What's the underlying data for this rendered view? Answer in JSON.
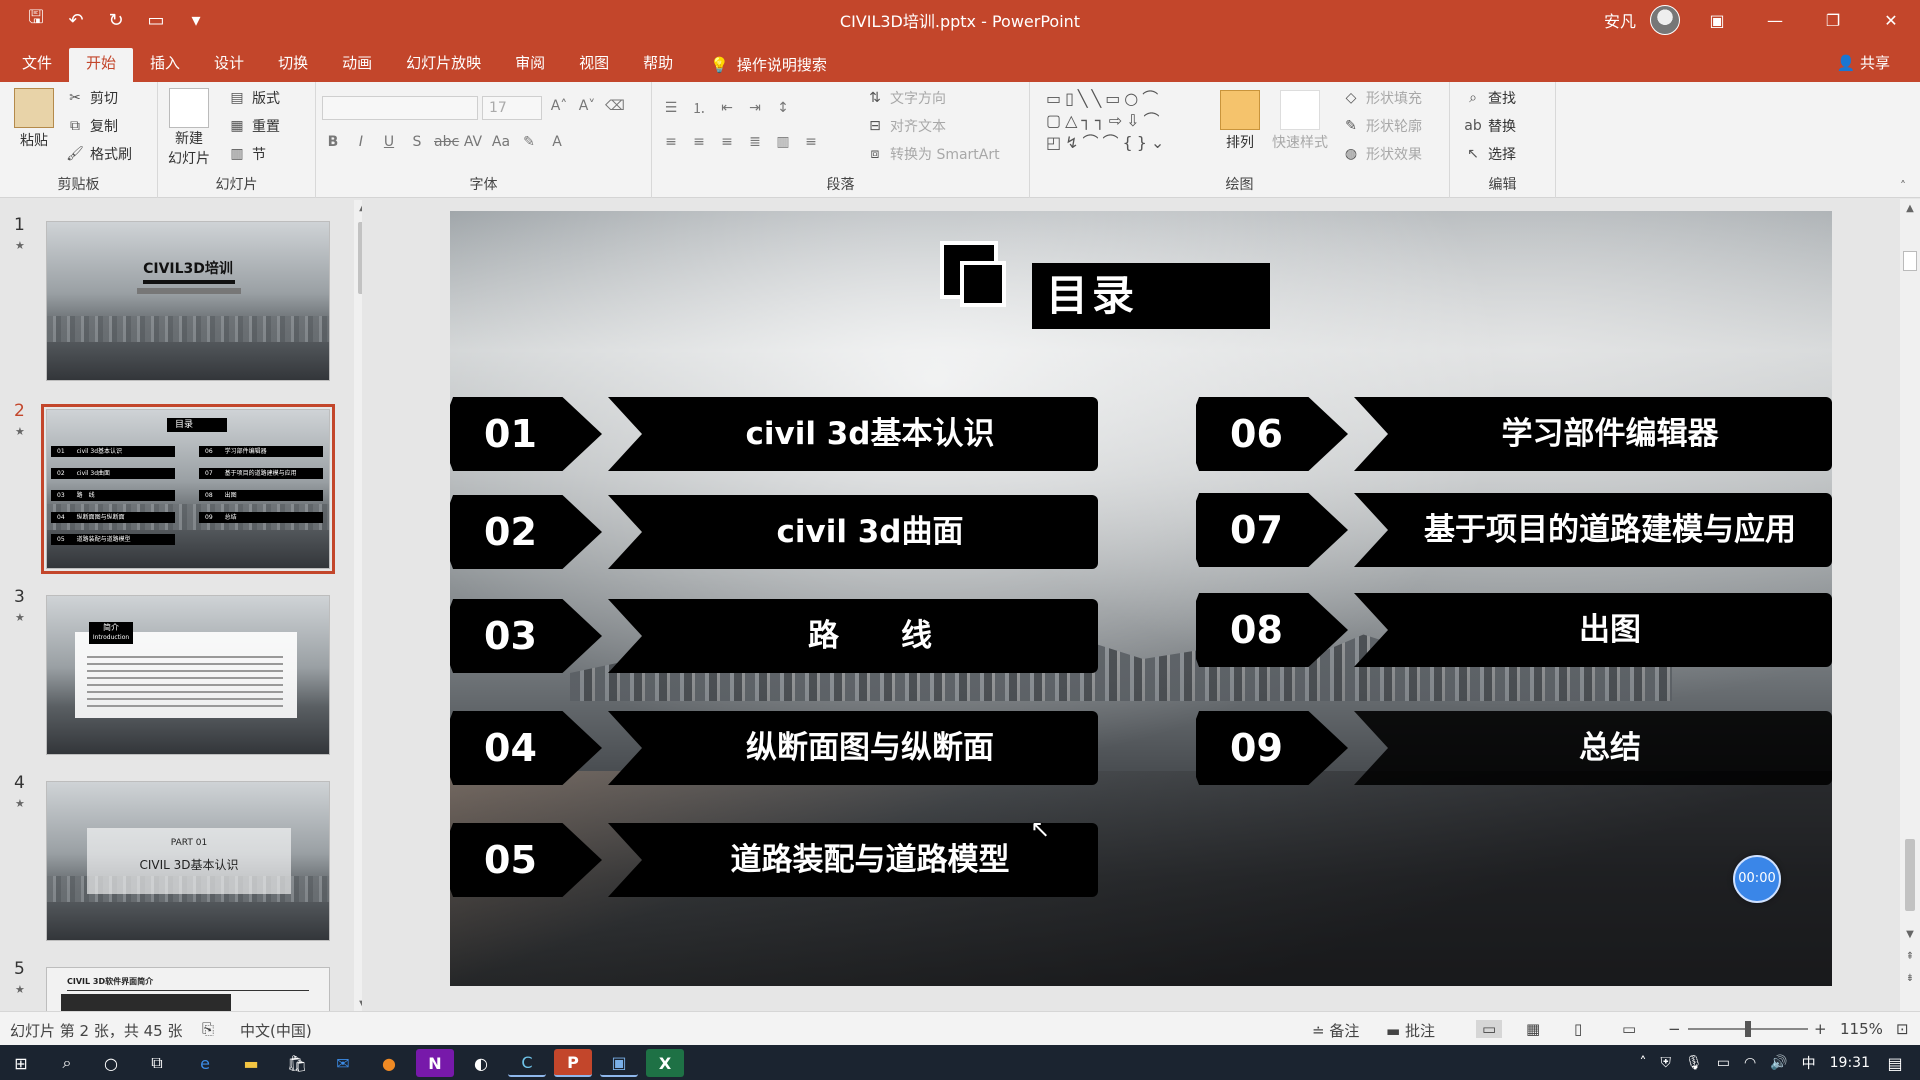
{
  "window": {
    "title": "CIVIL3D培训.pptx - PowerPoint",
    "user": "安凡"
  },
  "menu": {
    "tabs": [
      "文件",
      "开始",
      "插入",
      "设计",
      "切换",
      "动画",
      "幻灯片放映",
      "审阅",
      "视图",
      "帮助"
    ],
    "active_tab": "开始",
    "search_label": "操作说明搜索",
    "share_label": "共享"
  },
  "ribbon": {
    "clipboard": {
      "label": "剪贴板",
      "paste": "粘贴",
      "cut": "剪切",
      "copy": "复制",
      "format_painter": "格式刷"
    },
    "slides": {
      "label": "幻灯片",
      "new_slide": "新建",
      "new_slide2": "幻灯片",
      "layout": "版式",
      "reset": "重置",
      "section": "节"
    },
    "font": {
      "label": "字体",
      "size": "17"
    },
    "paragraph": {
      "label": "段落",
      "text_direction": "文字方向",
      "align_text": "对齐文本",
      "smartart": "转换为 SmartArt"
    },
    "drawing": {
      "label": "绘图",
      "arrange": "排列",
      "quick_styles": "快速样式",
      "shape_fill": "形状填充",
      "shape_outline": "形状轮廓",
      "shape_effects": "形状效果"
    },
    "editing": {
      "label": "编辑",
      "find": "查找",
      "replace": "替换",
      "select": "选择"
    }
  },
  "thumbnails": {
    "numbers": [
      "1",
      "2",
      "3",
      "4",
      "5"
    ],
    "active": "2",
    "t1_title": "CIVIL3D培训",
    "t2_title": "目录",
    "t3_tag1": "简介",
    "t3_tag2": "Introduction",
    "t4_part": "PART 01",
    "t4_name": "CIVIL 3D基本认识",
    "t5_title": "CIVIL 3D软件界面简介",
    "t2_rows": [
      {
        "n": "01",
        "t": "civil 3d基本认识"
      },
      {
        "n": "02",
        "t": "civil 3d曲面"
      },
      {
        "n": "03",
        "t": "路　线"
      },
      {
        "n": "04",
        "t": "纵断面图与纵断面"
      },
      {
        "n": "05",
        "t": "道路装配与道路模型"
      },
      {
        "n": "06",
        "t": "学习部件编辑器"
      },
      {
        "n": "07",
        "t": "基于项目的道路建模与应用"
      },
      {
        "n": "08",
        "t": "出图"
      },
      {
        "n": "09",
        "t": "总结"
      }
    ]
  },
  "slide": {
    "title": "目录",
    "left_items": [
      {
        "num": "01",
        "label": "civil 3d基本认识"
      },
      {
        "num": "02",
        "label": "civil 3d曲面"
      },
      {
        "num": "03",
        "label": "路　　线"
      },
      {
        "num": "04",
        "label": "纵断面图与纵断面"
      },
      {
        "num": "05",
        "label": "道路装配与道路模型"
      }
    ],
    "right_items": [
      {
        "num": "06",
        "label": "学习部件编辑器"
      },
      {
        "num": "07",
        "label": "基于项目的道路建模与应用"
      },
      {
        "num": "08",
        "label": "出图"
      },
      {
        "num": "09",
        "label": "总结"
      }
    ],
    "timer": "00:00"
  },
  "status": {
    "slide_info": "幻灯片 第 2 张，共 45 张",
    "language": "中文(中国)",
    "notes": "备注",
    "comments": "批注",
    "zoom": "115%"
  },
  "taskbar": {
    "time": "19:31",
    "ime": "中"
  }
}
